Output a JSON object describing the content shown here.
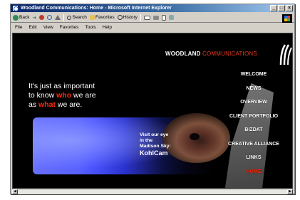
{
  "window": {
    "title": "Woodland Communications: Home - Microsoft Internet Explorer",
    "controls": [
      "_",
      "□",
      "×"
    ]
  },
  "toolbar": {
    "back_label": "Back",
    "search_label": "Search",
    "favorites_label": "Favorites",
    "history_label": "History"
  },
  "menu": [
    "File",
    "Edit",
    "View",
    "Favorites",
    "Tools",
    "Help"
  ],
  "page": {
    "brand_word1": "WOODLAND",
    "brand_word2": "COMMUNICATIONS",
    "tagline_1": "It's just as important",
    "tagline_2a": "to know ",
    "tagline_2b": "who",
    "tagline_2c": " we are",
    "tagline_3a": "as ",
    "tagline_3b": "what",
    "tagline_3c": " we are.",
    "promo_1": "Visit our eye",
    "promo_2": "in the",
    "promo_3": "Madison Sky:",
    "promo_4": "KohlCam",
    "nav": [
      "WELCOME",
      "NEWS",
      "OVERVIEW",
      "CLIENT PORTFOLIO",
      "BIZDAT",
      "CREATIVE ALLIANCE",
      "LINKS",
      "HOME"
    ],
    "active_nav": "HOME",
    "colors": {
      "accent_red": "#ff2a0a",
      "background": "#000000"
    }
  }
}
